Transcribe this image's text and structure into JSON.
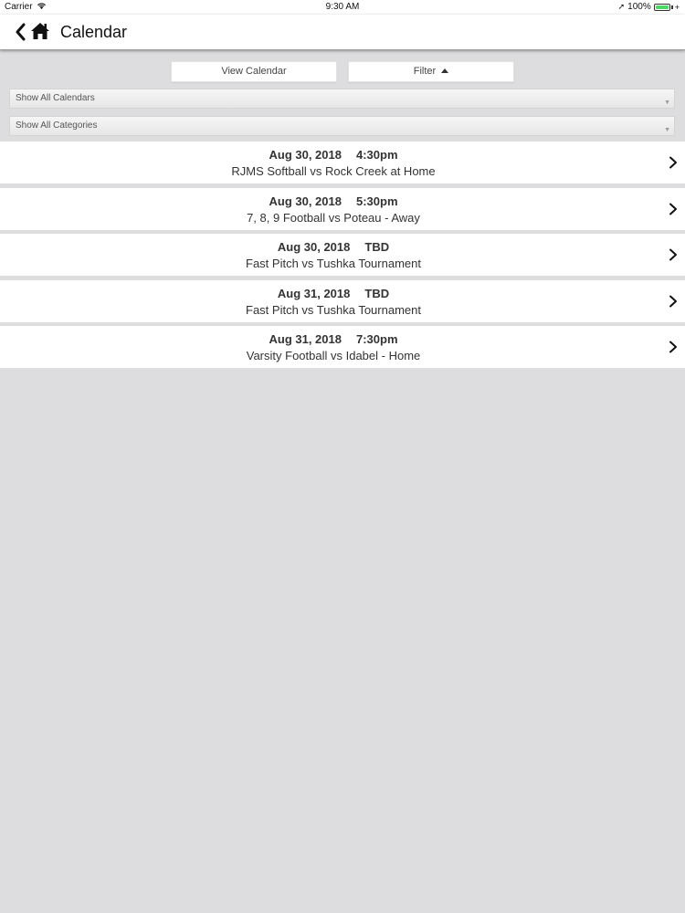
{
  "status_bar": {
    "carrier": "Carrier",
    "time": "9:30 AM",
    "battery": "100%"
  },
  "nav": {
    "title": "Calendar",
    "back_icon": "chevron-left-icon",
    "home_icon": "home-icon"
  },
  "toolbar": {
    "view_calendar_label": "View Calendar",
    "filter_label": "Filter"
  },
  "filters": {
    "calendars_selected": "Show All Calendars",
    "categories_selected": "Show All Categories"
  },
  "events": [
    {
      "date": "Aug 30, 2018",
      "time": "4:30pm",
      "title": "RJMS Softball vs Rock Creek at Home"
    },
    {
      "date": "Aug 30, 2018",
      "time": "5:30pm",
      "title": "7, 8, 9 Football vs Poteau - Away"
    },
    {
      "date": "Aug 30, 2018",
      "time": "TBD",
      "title": "Fast Pitch vs Tushka Tournament"
    },
    {
      "date": "Aug 31, 2018",
      "time": "TBD",
      "title": "Fast Pitch vs Tushka Tournament"
    },
    {
      "date": "Aug 31, 2018",
      "time": "7:30pm",
      "title": "Varsity Football vs Idabel - Home"
    }
  ],
  "colors": {
    "background": "#dddcde",
    "row_background": "#ffffff",
    "battery_green": "#4cd964"
  }
}
